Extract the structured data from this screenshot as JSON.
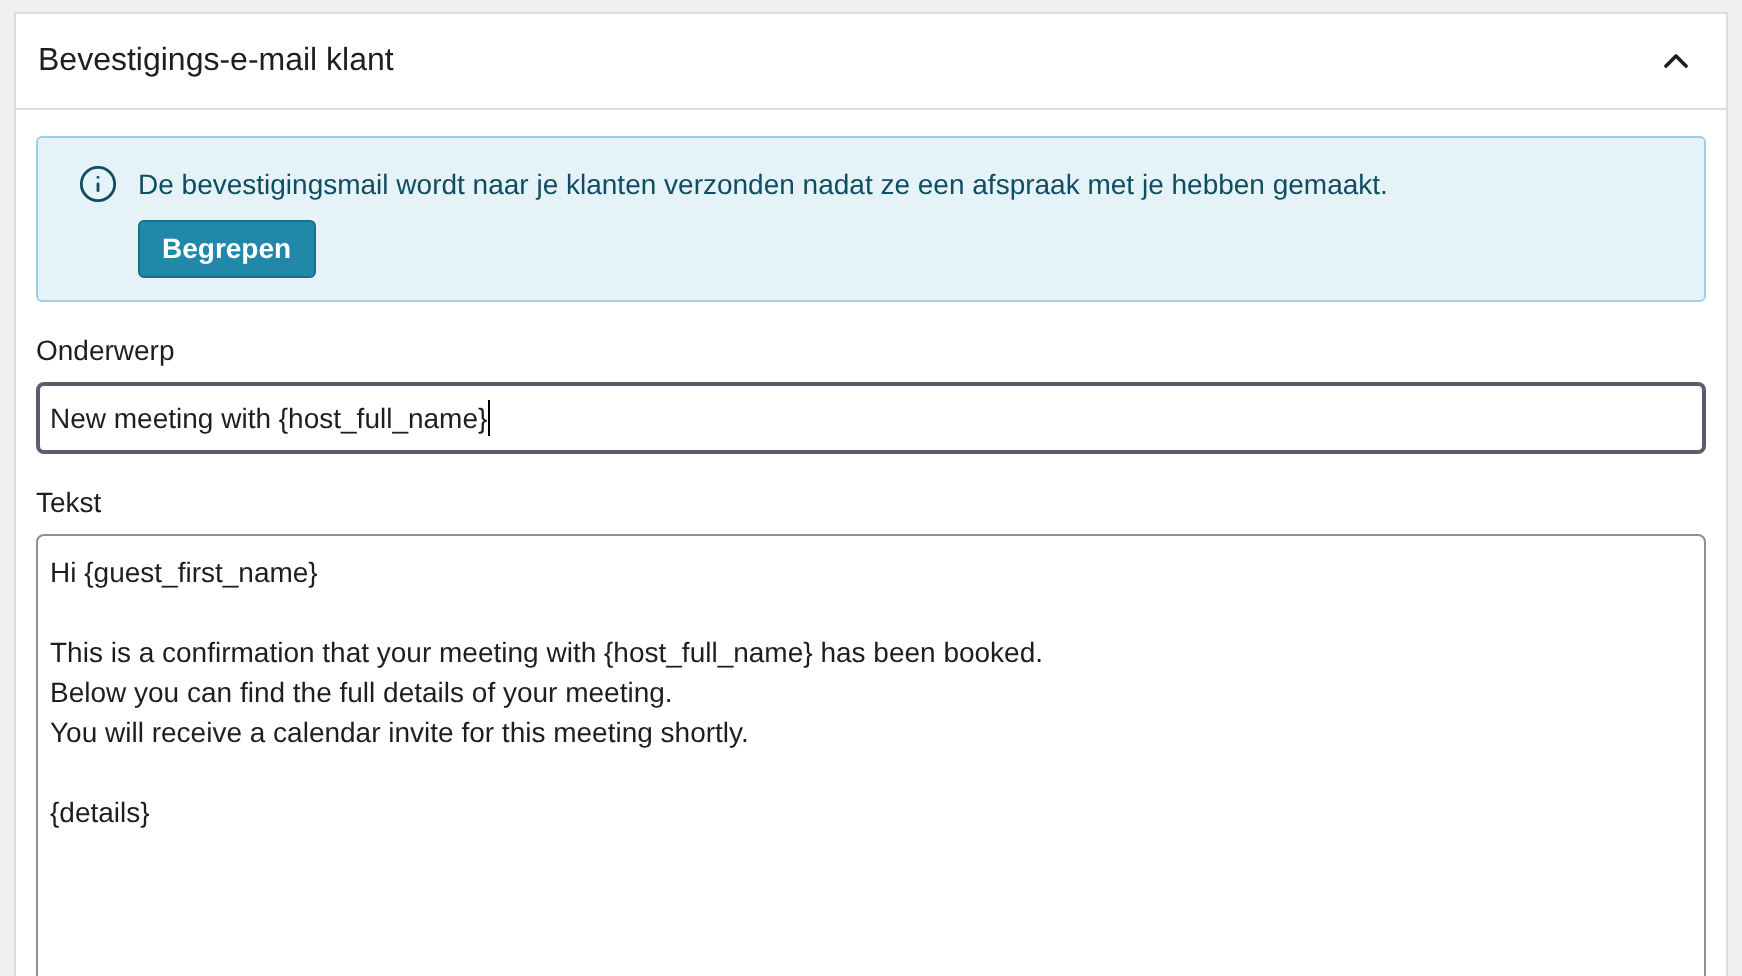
{
  "panel": {
    "title": "Bevestigings-e-mail klant",
    "expanded": true
  },
  "notice": {
    "text": "De bevestigingsmail wordt naar je klanten verzonden nadat ze een afspraak met je hebben gemaakt.",
    "button": "Begrepen"
  },
  "subject": {
    "label": "Onderwerp",
    "value": "New meeting with {host_full_name}",
    "focused": true
  },
  "body": {
    "label": "Tekst",
    "paragraphs": [
      [
        "Hi {guest_first_name}"
      ],
      [
        "This is a confirmation that your meeting with {host_full_name} has been booked.",
        "Below you can find the full details of your meeting.",
        "You will receive a calendar invite for this meeting shortly."
      ],
      [
        "{details}"
      ]
    ]
  }
}
